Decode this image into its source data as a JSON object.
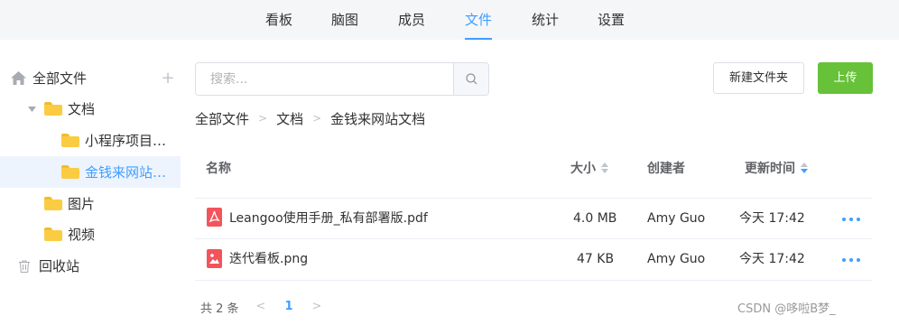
{
  "nav": {
    "tabs": [
      {
        "label": "看板"
      },
      {
        "label": "脑图"
      },
      {
        "label": "成员"
      },
      {
        "label": "文件",
        "active": true
      },
      {
        "label": "统计"
      },
      {
        "label": "设置"
      }
    ]
  },
  "sidebar": {
    "root": {
      "label": "全部文件",
      "icon": "home-icon",
      "add_icon": "plus-icon"
    },
    "items": [
      {
        "label": "文档",
        "expanded": true
      },
      {
        "label": "小程序项目…"
      },
      {
        "label": "金钱来网站…",
        "selected": true
      },
      {
        "label": "图片"
      },
      {
        "label": "视频"
      },
      {
        "label": "回收站",
        "icon": "trash-icon"
      }
    ]
  },
  "toolbar": {
    "search_placeholder": "搜索...",
    "new_folder_label": "新建文件夹",
    "upload_label": "上传"
  },
  "breadcrumb": [
    "全部文件",
    "文档",
    "金钱来网站文档"
  ],
  "table": {
    "columns": [
      "名称",
      "大小",
      "创建者",
      "更新时间"
    ],
    "rows": [
      {
        "name": "Leangoo使用手册_私有部署版.pdf",
        "size": "4.0 MB",
        "creator": "Amy Guo",
        "updated": "今天 17:42",
        "icon": "pdf-file-icon"
      },
      {
        "name": "迭代看板.png",
        "size": "47 KB",
        "creator": "Amy Guo",
        "updated": "今天 17:42",
        "icon": "image-file-icon"
      }
    ]
  },
  "pagination": {
    "total_label": "共 2 条",
    "current_page": "1"
  },
  "watermark": "CSDN @哆啦B梦_",
  "colors": {
    "accent": "#409eff",
    "upload": "#67c23a",
    "folder": "#fbcc42",
    "file_icon": "#f2545b"
  }
}
